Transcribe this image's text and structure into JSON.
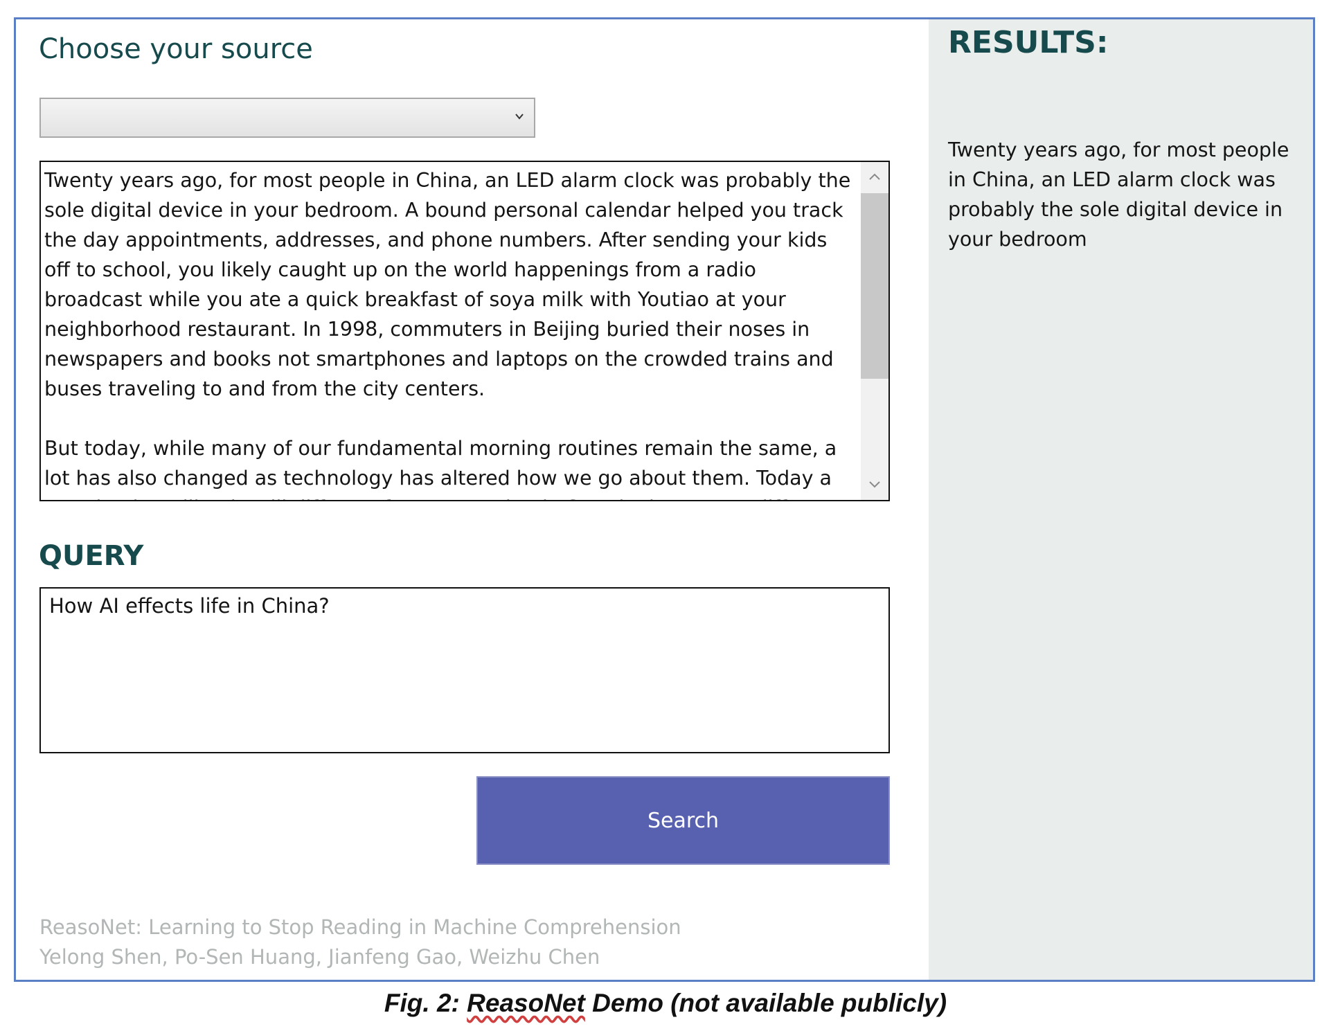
{
  "source": {
    "title": "Choose your source",
    "selected": ""
  },
  "article": {
    "paragraphs": [
      "Twenty years ago, for most people in China, an LED alarm clock was probably the sole digital device in your bedroom. A bound personal calendar helped you track the day appointments, addresses, and phone numbers. After sending your kids off to school, you likely caught up on the world happenings from a radio broadcast while you ate a quick breakfast of soya milk with Youtiao at your neighborhood restaurant. In 1998, commuters in Beijing buried their noses in newspapers and books  not smartphones and laptops  on the crowded trains and buses traveling to and from the city centers.",
      "But today, while many of our fundamental morning routines remain the same, a lot has also changed as technology has altered how we go about them. Today a morning in Beijing is still different from a morning in Seattle, but not as different as it used to be. Consider for a moment that in both places the smartphone alarm is on your bedside table in the dark"
    ]
  },
  "query": {
    "title": "QUERY",
    "value": "How AI effects life in China?"
  },
  "search_button": {
    "label": "Search"
  },
  "results": {
    "title": "RESULTS:",
    "text": "Twenty years ago, for most people in China, an LED alarm clock was probably the sole digital device in your bedroom"
  },
  "footer": {
    "paper_title": "ReasoNet: Learning to Stop Reading in Machine Comprehension",
    "authors": "Yelong Shen, Po-Sen Huang, Jianfeng Gao, Weizhu Chen"
  },
  "caption": {
    "prefix": "Fig. 2: ",
    "name": "ReasoNet",
    "suffix": " Demo (not available publicly)"
  },
  "icons": {
    "select": "chevron-down-icon",
    "scroll_up": "chevron-up-icon",
    "scroll_down": "chevron-down-icon"
  },
  "colors": {
    "heading": "#164a4c",
    "button": "#5761b0",
    "results_panel": "#e9edec",
    "frame_border": "#5b7fc4",
    "footer_text": "#b2b6b6"
  }
}
